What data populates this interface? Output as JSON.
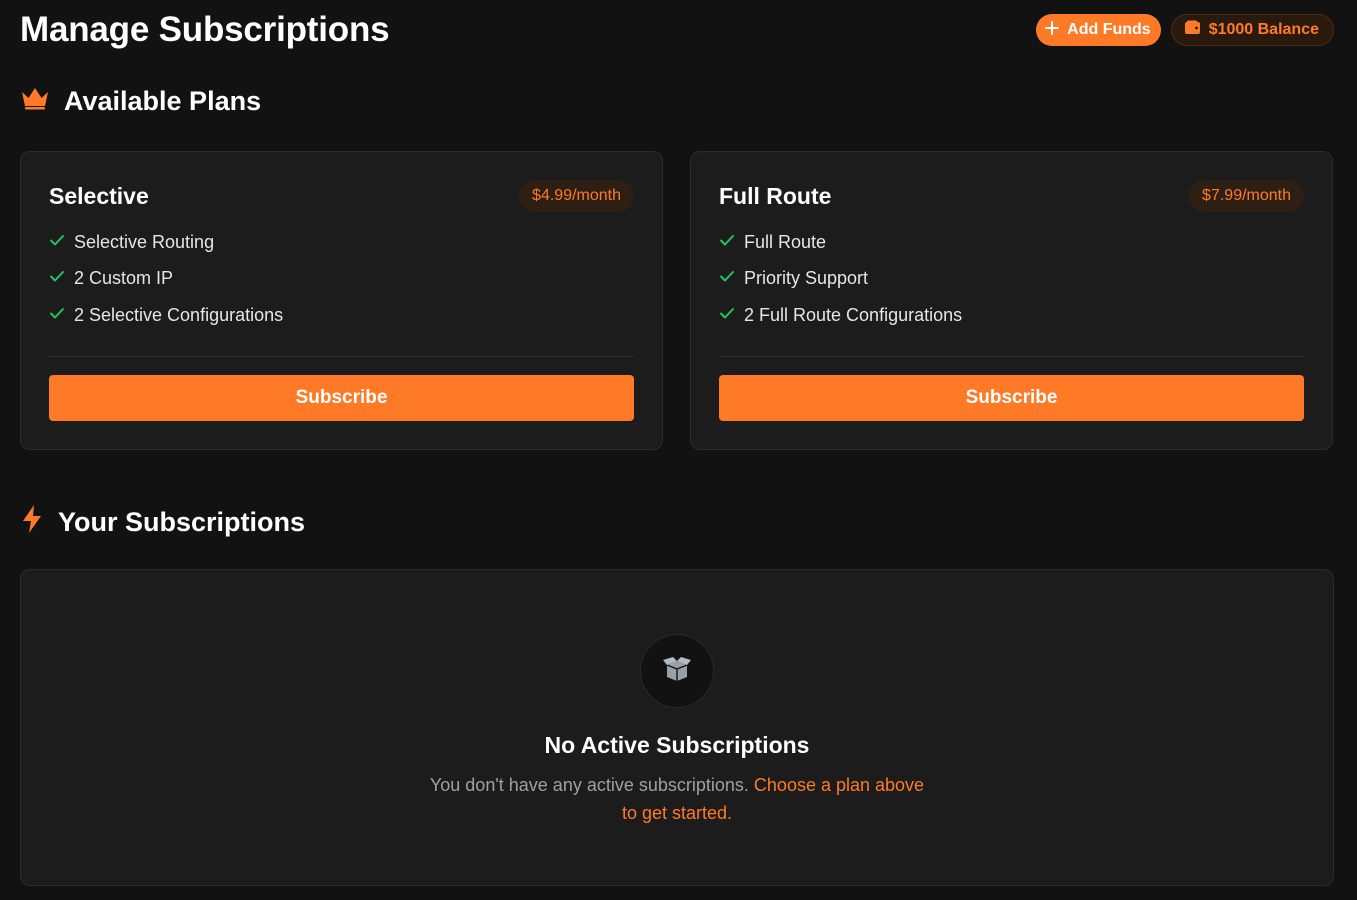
{
  "header": {
    "title": "Manage Subscriptions",
    "add_funds_label": "Add Funds",
    "balance_label": "$1000 Balance"
  },
  "available_plans": {
    "heading": "Available Plans",
    "plans": [
      {
        "name": "Selective",
        "price": "$4.99/month",
        "features": [
          "Selective Routing",
          "2 Custom IP",
          "2 Selective Configurations"
        ],
        "button_label": "Subscribe"
      },
      {
        "name": "Full Route",
        "price": "$7.99/month",
        "features": [
          "Full Route",
          "Priority Support",
          "2 Full Route Configurations"
        ],
        "button_label": "Subscribe"
      }
    ]
  },
  "your_subscriptions": {
    "heading": "Your Subscriptions",
    "empty_title": "No Active Subscriptions",
    "empty_text": "You don't have any active subscriptions.",
    "empty_link": "Choose a plan above to get started."
  },
  "icons": {
    "add": "plus-icon",
    "balance": "wallet-icon",
    "plans_heading": "crown-icon",
    "subscriptions_heading": "lightning-bolt-icon",
    "feature": "check-icon",
    "empty_state": "open-box-icon"
  },
  "colors": {
    "accent": "#ff7a26",
    "check": "#22c55e",
    "background": "#121212",
    "card": "#1c1c1c"
  }
}
